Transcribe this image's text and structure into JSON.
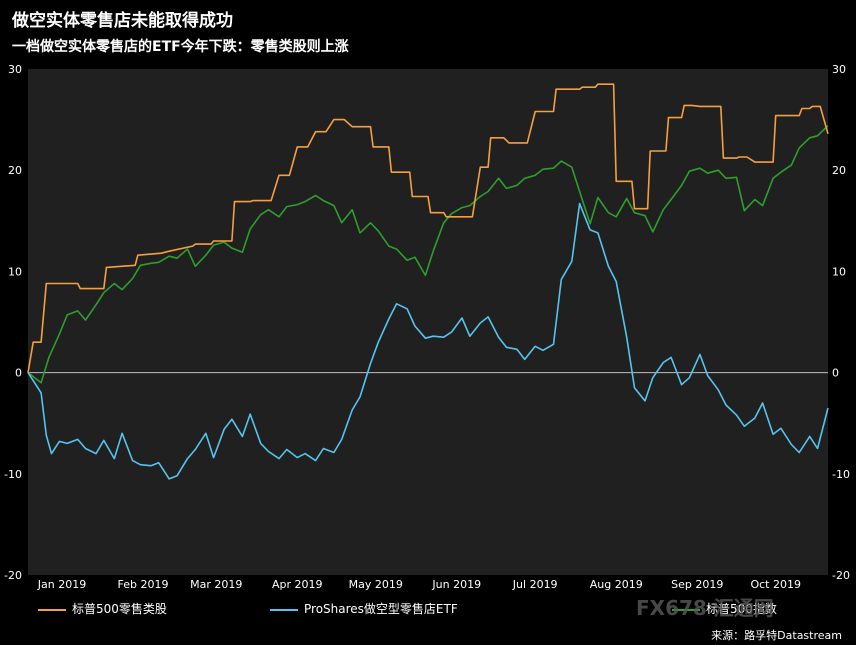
{
  "title": "做空实体零售店未能取得成功",
  "subtitle": "一档做空实体零售店的ETF今年下跌：零售类股则上涨",
  "source": "来源：路孚特Datastream",
  "watermark": "FX678 汇通网",
  "colors": {
    "background": "#000000",
    "plot_background": "#202020",
    "retail": "#f5a040",
    "etf": "#55c4ee",
    "sp500": "#2e9e2e",
    "zero_line": "#bdbdbd"
  },
  "chart_data": {
    "type": "line",
    "title": "做空实体零售店未能取得成功",
    "subtitle": "一档做空实体零售店的ETF今年下跌：零售类股则上涨",
    "xlabel": "",
    "ylabel": "",
    "ylim": [
      -20,
      30
    ],
    "yticks": [
      -20,
      -10,
      0,
      10,
      20,
      30
    ],
    "ytick_labels": [
      "-20",
      "-10",
      "0",
      "10",
      "20",
      "30"
    ],
    "secondary_axis": "right",
    "grid": false,
    "legend_position": "bottom",
    "x_range": [
      "2019-01-02",
      "2019-11-04"
    ],
    "x_ticks": [
      "2019-01-15",
      "2019-02-15",
      "2019-03-15",
      "2019-04-15",
      "2019-05-15",
      "2019-06-15",
      "2019-07-15",
      "2019-08-15",
      "2019-09-15",
      "2019-10-15"
    ],
    "x_tick_labels": [
      "Jan 2019",
      "Feb 2019",
      "Mar 2019",
      "Apr 2019",
      "May 2019",
      "Jun 2019",
      "Jul 2019",
      "Aug 2019",
      "Sep 2019",
      "Oct 2019"
    ],
    "series": [
      {
        "name": "标普500零售类股",
        "color": "#f5a040",
        "x": [
          "2019-01-02",
          "2019-01-04",
          "2019-01-07",
          "2019-01-09",
          "2019-01-11",
          "2019-01-21",
          "2019-01-22",
          "2019-01-28",
          "2019-01-31",
          "2019-02-01",
          "2019-02-12",
          "2019-02-13",
          "2019-02-22",
          "2019-02-25",
          "2019-03-06",
          "2019-03-07",
          "2019-03-13",
          "2019-03-14",
          "2019-03-21",
          "2019-03-22",
          "2019-03-28",
          "2019-03-29",
          "2019-04-05",
          "2019-04-08",
          "2019-04-12",
          "2019-04-15",
          "2019-04-19",
          "2019-04-22",
          "2019-04-26",
          "2019-04-29",
          "2019-05-03",
          "2019-05-06",
          "2019-05-13",
          "2019-05-14",
          "2019-05-20",
          "2019-05-21",
          "2019-05-28",
          "2019-05-29",
          "2019-06-04",
          "2019-06-05",
          "2019-06-10",
          "2019-06-11",
          "2019-06-21",
          "2019-06-24",
          "2019-06-27",
          "2019-06-28",
          "2019-07-03",
          "2019-07-05",
          "2019-07-12",
          "2019-07-15",
          "2019-07-22",
          "2019-07-23",
          "2019-08-01",
          "2019-08-02",
          "2019-08-07",
          "2019-08-08",
          "2019-08-14",
          "2019-08-15",
          "2019-08-21",
          "2019-08-22",
          "2019-08-27",
          "2019-08-28",
          "2019-09-03",
          "2019-09-04",
          "2019-09-09",
          "2019-09-10",
          "2019-09-13",
          "2019-09-16",
          "2019-09-24",
          "2019-09-25",
          "2019-09-30",
          "2019-10-01",
          "2019-10-04",
          "2019-10-07",
          "2019-10-14",
          "2019-10-15",
          "2019-10-24",
          "2019-10-25",
          "2019-10-28",
          "2019-10-29",
          "2019-11-01",
          "2019-11-04"
        ],
        "values": [
          0,
          3,
          3,
          8.8,
          8.8,
          8.8,
          8.3,
          8.3,
          8.3,
          10.4,
          10.6,
          11.6,
          11.8,
          12,
          12.5,
          12.7,
          12.7,
          13,
          13,
          16.9,
          16.9,
          17,
          17,
          19.5,
          19.5,
          22.3,
          22.3,
          23.8,
          23.8,
          25,
          25,
          24.3,
          24.3,
          22.3,
          22.3,
          19.8,
          19.8,
          17.4,
          17.4,
          15.8,
          15.8,
          15.4,
          15.4,
          20.3,
          20.3,
          23.2,
          23.2,
          22.7,
          22.7,
          25.8,
          25.8,
          28,
          28,
          28.2,
          28.2,
          28.5,
          28.5,
          18.9,
          18.9,
          16.2,
          16.2,
          21.9,
          21.9,
          25.2,
          25.2,
          26.4,
          26.4,
          26.3,
          26.3,
          21.2,
          21.2,
          21.3,
          21.3,
          20.8,
          20.8,
          25.4,
          25.4,
          26.1,
          26.1,
          26.3,
          26.3,
          23.6
        ]
      },
      {
        "name": "ProShares做空型零售店ETF",
        "color": "#55c4ee",
        "x": [
          "2019-01-02",
          "2019-01-07",
          "2019-01-09",
          "2019-01-11",
          "2019-01-14",
          "2019-01-17",
          "2019-01-21",
          "2019-01-24",
          "2019-01-28",
          "2019-01-31",
          "2019-02-04",
          "2019-02-07",
          "2019-02-11",
          "2019-02-14",
          "2019-02-18",
          "2019-02-21",
          "2019-02-25",
          "2019-02-28",
          "2019-03-04",
          "2019-03-07",
          "2019-03-11",
          "2019-03-14",
          "2019-03-18",
          "2019-03-21",
          "2019-03-25",
          "2019-03-28",
          "2019-04-01",
          "2019-04-04",
          "2019-04-08",
          "2019-04-11",
          "2019-04-15",
          "2019-04-18",
          "2019-04-22",
          "2019-04-25",
          "2019-04-29",
          "2019-05-02",
          "2019-05-06",
          "2019-05-09",
          "2019-05-13",
          "2019-05-16",
          "2019-05-20",
          "2019-05-23",
          "2019-05-27",
          "2019-05-30",
          "2019-06-03",
          "2019-06-06",
          "2019-06-10",
          "2019-06-13",
          "2019-06-17",
          "2019-06-20",
          "2019-06-24",
          "2019-06-27",
          "2019-07-01",
          "2019-07-04",
          "2019-07-08",
          "2019-07-11",
          "2019-07-15",
          "2019-07-18",
          "2019-07-22",
          "2019-07-25",
          "2019-07-29",
          "2019-08-01",
          "2019-08-05",
          "2019-08-08",
          "2019-08-12",
          "2019-08-15",
          "2019-08-19",
          "2019-08-22",
          "2019-08-26",
          "2019-08-29",
          "2019-09-02",
          "2019-09-05",
          "2019-09-09",
          "2019-09-12",
          "2019-09-16",
          "2019-09-19",
          "2019-09-23",
          "2019-09-26",
          "2019-09-30",
          "2019-10-03",
          "2019-10-07",
          "2019-10-10",
          "2019-10-14",
          "2019-10-17",
          "2019-10-21",
          "2019-10-24",
          "2019-10-28",
          "2019-10-31",
          "2019-11-04"
        ],
        "values": [
          0,
          -2,
          -6.2,
          -8,
          -6.8,
          -7,
          -6.6,
          -7.5,
          -8,
          -6.7,
          -8.5,
          -6,
          -8.7,
          -9.1,
          -9.2,
          -8.9,
          -10.5,
          -10.2,
          -8.5,
          -7.6,
          -6,
          -8.4,
          -5.6,
          -4.6,
          -6.3,
          -4.1,
          -7,
          -7.8,
          -8.5,
          -7.6,
          -8.4,
          -8,
          -8.7,
          -7.5,
          -7.9,
          -6.6,
          -3.7,
          -2.4,
          0.9,
          3,
          5.3,
          6.8,
          6.3,
          4.6,
          3.4,
          3.6,
          3.5,
          4,
          5.4,
          3.6,
          4.9,
          5.5,
          3.5,
          2.5,
          2.3,
          1.3,
          2.6,
          2.2,
          2.8,
          9.2,
          11,
          16.7,
          14.1,
          13.8,
          10.5,
          9,
          3.5,
          -1.5,
          -2.8,
          -0.5,
          1,
          1.5,
          -1.2,
          -0.5,
          1.8,
          -0.3,
          -1.7,
          -3.2,
          -4.2,
          -5.3,
          -4.5,
          -3,
          -6.1,
          -5.5,
          -7.1,
          -7.9,
          -6.3,
          -7.5,
          -3.5
        ]
      },
      {
        "name": "标普500指数",
        "color": "#2e9e2e",
        "x": [
          "2019-01-02",
          "2019-01-07",
          "2019-01-10",
          "2019-01-14",
          "2019-01-17",
          "2019-01-21",
          "2019-01-24",
          "2019-01-28",
          "2019-01-31",
          "2019-02-04",
          "2019-02-07",
          "2019-02-11",
          "2019-02-14",
          "2019-02-18",
          "2019-02-21",
          "2019-02-25",
          "2019-02-28",
          "2019-03-04",
          "2019-03-07",
          "2019-03-11",
          "2019-03-14",
          "2019-03-18",
          "2019-03-21",
          "2019-03-25",
          "2019-03-28",
          "2019-04-01",
          "2019-04-04",
          "2019-04-08",
          "2019-04-11",
          "2019-04-15",
          "2019-04-18",
          "2019-04-22",
          "2019-04-25",
          "2019-04-29",
          "2019-05-02",
          "2019-05-06",
          "2019-05-09",
          "2019-05-13",
          "2019-05-16",
          "2019-05-20",
          "2019-05-23",
          "2019-05-27",
          "2019-05-30",
          "2019-06-03",
          "2019-06-06",
          "2019-06-10",
          "2019-06-13",
          "2019-06-17",
          "2019-06-20",
          "2019-06-24",
          "2019-06-27",
          "2019-07-01",
          "2019-07-04",
          "2019-07-08",
          "2019-07-11",
          "2019-07-15",
          "2019-07-18",
          "2019-07-22",
          "2019-07-25",
          "2019-07-29",
          "2019-08-01",
          "2019-08-05",
          "2019-08-08",
          "2019-08-12",
          "2019-08-15",
          "2019-08-19",
          "2019-08-22",
          "2019-08-26",
          "2019-08-29",
          "2019-09-02",
          "2019-09-05",
          "2019-09-09",
          "2019-09-12",
          "2019-09-16",
          "2019-09-19",
          "2019-09-23",
          "2019-09-26",
          "2019-09-30",
          "2019-10-03",
          "2019-10-07",
          "2019-10-10",
          "2019-10-14",
          "2019-10-17",
          "2019-10-21",
          "2019-10-24",
          "2019-10-28",
          "2019-10-31",
          "2019-11-04"
        ],
        "values": [
          0,
          -1,
          1.5,
          3.8,
          5.7,
          6.1,
          5.2,
          6.7,
          7.9,
          8.8,
          8.2,
          9.3,
          10.6,
          10.8,
          10.9,
          11.5,
          11.3,
          12.2,
          10.5,
          11.6,
          12.6,
          12.9,
          12.3,
          11.9,
          14.2,
          15.6,
          16.1,
          15.4,
          16.4,
          16.6,
          16.9,
          17.5,
          17,
          16.5,
          14.8,
          16.1,
          13.8,
          14.8,
          14,
          12.5,
          12.2,
          11.1,
          11.4,
          9.6,
          12,
          14.8,
          15.7,
          16.3,
          16.5,
          17.4,
          17.9,
          19.2,
          18.2,
          18.5,
          19.2,
          19.5,
          20.1,
          20.2,
          20.9,
          20.3,
          17.9,
          14.7,
          17.3,
          15.8,
          15.4,
          17.2,
          15.8,
          15.5,
          13.9,
          16.1,
          17.1,
          18.5,
          19.9,
          20.2,
          19.7,
          20,
          19.2,
          19.3,
          16,
          17.1,
          16.5,
          19.2,
          19.8,
          20.5,
          22.2,
          23.2,
          23.4,
          24.4
        ]
      }
    ]
  }
}
